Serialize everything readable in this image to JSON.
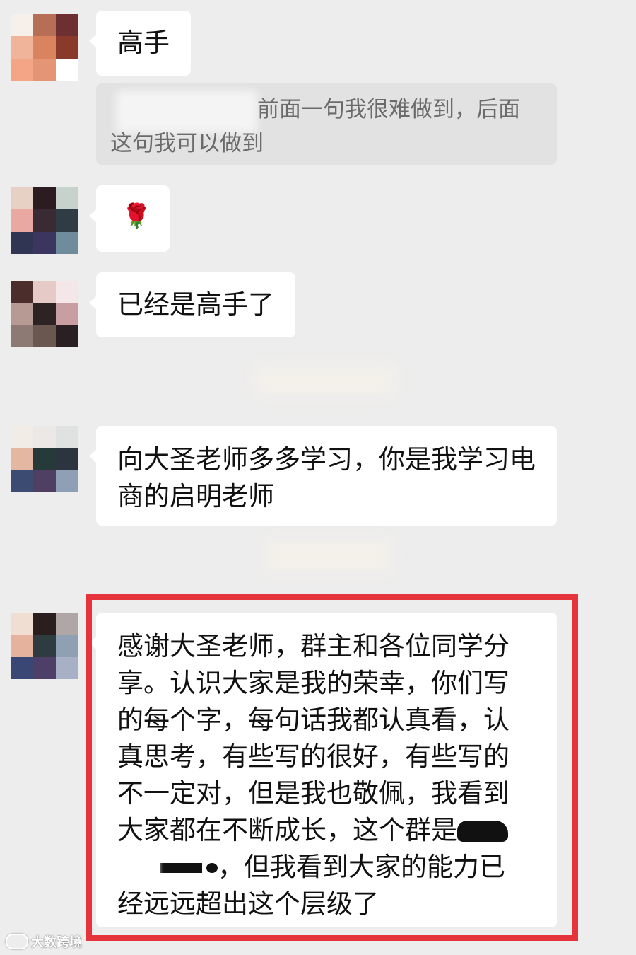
{
  "messages": [
    {
      "text": "高手"
    },
    {
      "quote_line1": "前面一句我很难做到，后面",
      "quote_line2": "这句我可以做到"
    },
    {
      "emoji": "🌹"
    },
    {
      "text": "已经是高手了"
    },
    {
      "text": "向大圣老师多多学习，你是我学习电商的启明老师"
    },
    {
      "line1": "感谢大圣老师，群主和各位同学分",
      "line2": "享。认识大家是我的荣幸，你们写",
      "line3": "的每个字，每句话我都认真看，认",
      "line4": "真思考，有些写的很好，有些写的",
      "line5": "不一定对，但是我也敬佩，我看到",
      "line6": "大家都在不断成长，这个群是",
      "line7": "，但我看到大家的能力已",
      "line8": "经远远超出这个层级了"
    }
  ],
  "watermark": {
    "text": "大数跨境"
  }
}
